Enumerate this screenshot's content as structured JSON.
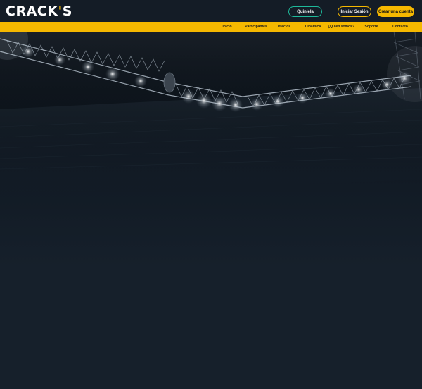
{
  "header": {
    "logo": {
      "main": "CRACK",
      "accent": "'",
      "end": "S"
    },
    "buttons": {
      "quiniela": "Quiniela",
      "login": "Iniciar Sesión",
      "register": "Crear una cuenta"
    }
  },
  "nav": {
    "items": [
      "Inicio",
      "Participantes",
      "Precios",
      "Dinamica",
      "¿Quién somos?",
      "Soporte",
      "Contacto"
    ]
  },
  "colors": {
    "brand_yellow": "#f5b800",
    "teal_accent": "#1eb99a",
    "header_bg": "#141c26",
    "page_bg": "#16202b"
  },
  "hero": {
    "image": "stadium-lights-truss"
  }
}
